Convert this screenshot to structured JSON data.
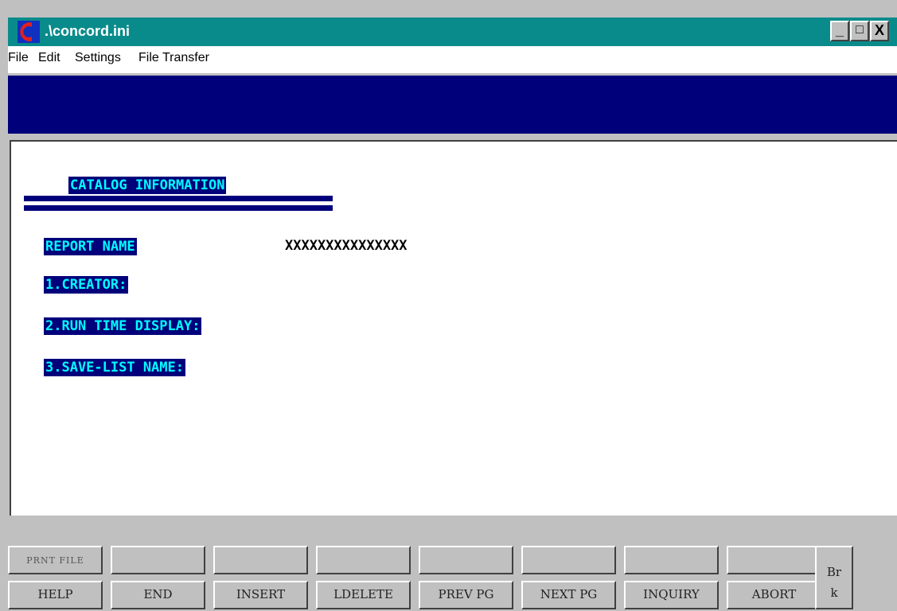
{
  "window": {
    "title": ".\\concord.ini",
    "controls": {
      "minimize": "_",
      "maximize": "□",
      "close": "X"
    }
  },
  "menu": {
    "items": [
      "File",
      "Edit",
      "Settings",
      "File Transfer"
    ]
  },
  "screen": {
    "heading": "CATALOG INFORMATION",
    "report_name_label": "REPORT NAME",
    "report_name_value": "XXXXXXXXXXXXXXX",
    "fields": [
      "1.CREATOR:",
      "2.RUN TIME DISPLAY:",
      "3.SAVE-LIST NAME:"
    ]
  },
  "function_keys": {
    "top_row": [
      "PRNT FILE",
      "",
      "",
      "",
      "",
      "",
      "",
      ""
    ],
    "bottom_row": [
      "HELP",
      "END",
      "INSERT",
      "LDELETE",
      "PREV PG",
      "NEXT PG",
      "INQUIRY",
      "ABORT"
    ],
    "break_label_1": "Br",
    "break_label_2": "k"
  },
  "colors": {
    "titlebar": "#0a8b8b",
    "banner": "#00007b",
    "highlight_bg": "#00007b",
    "highlight_fg": "#00ffff",
    "chrome": "#c0c0c0"
  },
  "icons": {
    "app": "concord-app-icon"
  }
}
